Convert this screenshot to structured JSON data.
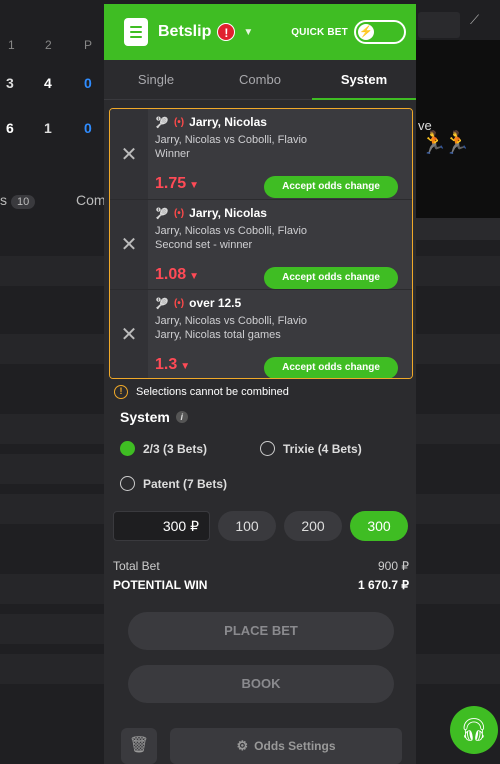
{
  "background": {
    "columns": [
      "1",
      "2",
      "P"
    ],
    "score_row1": [
      "3",
      "4",
      "0"
    ],
    "score_row2": [
      "6",
      "1",
      "0"
    ],
    "tab_left_label": "s",
    "tab_left_count": "10",
    "tab_right_label": "Com",
    "stream_text": "ve"
  },
  "header": {
    "title": "Betslip",
    "alert": "!",
    "quick_bet_label": "QUICK BET",
    "toggle_icon": "⚡"
  },
  "tabs": [
    {
      "label": "Single"
    },
    {
      "label": "Combo"
    },
    {
      "label": "System"
    }
  ],
  "bets": [
    {
      "title": "Jarry, Nicolas",
      "match": "Jarry, Nicolas vs Cobolli, Flavio",
      "market": "Winner",
      "odds": "1.75",
      "accept_label": "Accept odds change"
    },
    {
      "title": "Jarry, Nicolas",
      "match": "Jarry, Nicolas vs Cobolli, Flavio",
      "market": "Second set - winner",
      "odds": "1.08",
      "accept_label": "Accept odds change"
    },
    {
      "title": "over 12.5",
      "match": "Jarry, Nicolas vs Cobolli, Flavio",
      "market": "Jarry, Nicolas total games",
      "odds": "1.3",
      "accept_label": "Accept odds change"
    }
  ],
  "notice": "Selections cannot be combined",
  "system": {
    "label": "System",
    "options": [
      {
        "label": "2/3 (3 Bets)",
        "selected": true
      },
      {
        "label": "Trixie (4 Bets)",
        "selected": false
      },
      {
        "label": "Patent (7 Bets)",
        "selected": false
      }
    ]
  },
  "stake": {
    "value": "300 ₽",
    "quick": [
      "100",
      "200",
      "300"
    ],
    "selected": "300"
  },
  "totals": {
    "total_bet_label": "Total Bet",
    "total_bet_value": "900 ₽",
    "potential_win_label": "POTENTIAL WIN",
    "potential_win_value": "1 670.7 ₽"
  },
  "actions": {
    "place_bet": "PLACE BET",
    "book": "BOOK",
    "odds_settings": "Odds Settings"
  },
  "colors": {
    "brand_green": "#3fbd23",
    "odds_red": "#ff4a56",
    "warning_orange": "#f0a929"
  }
}
